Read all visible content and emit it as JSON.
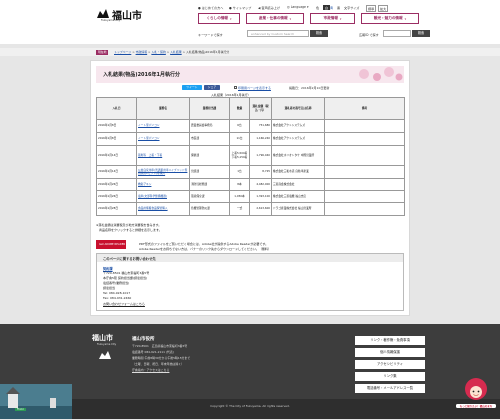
{
  "header": {
    "logo_text": "福山市",
    "logo_sub": "Fukuyama City",
    "util": [
      {
        "icon": "chevron-circle-icon",
        "label": "はじめての方へ"
      },
      {
        "icon": "chevron-circle-icon",
        "label": "サイトマップ"
      },
      {
        "icon": "speaker-icon",
        "label": "音声読み上げ"
      },
      {
        "icon": "globe-icon",
        "label": "Language"
      },
      {
        "label": "色",
        "selected": false
      },
      {
        "label": "白",
        "selected": true
      },
      {
        "label": "青",
        "selected": false
      },
      {
        "label": "黒",
        "selected": false
      },
      {
        "label": "文字サイズ"
      },
      {
        "label": "標準"
      },
      {
        "label": "拡大"
      }
    ],
    "nav": [
      "くらしの情報",
      "産業・仕事の情報",
      "市政情報",
      "観光・魅力の情報"
    ],
    "search": {
      "label": "キーワードで探す",
      "placeholder": "enhanced by Custom Search",
      "button": "検索"
    },
    "ad_search": {
      "label": "広報ID で探す",
      "button": "検索"
    }
  },
  "breadcrumb": {
    "tag": "現在地",
    "items": [
      "トップページ",
      "市政情報",
      "入札・契約",
      "入札結果",
      "入札結果(物品)2016年1月執行分"
    ]
  },
  "page": {
    "title": "入札結果(物品)2016年1月執行分",
    "tweet": "ツイート",
    "share": "シェア",
    "print": "印刷用ページを表示する",
    "updated": "掲載日：2016年2月10日更新",
    "caption": "入札結果（2016年1月執行）"
  },
  "table": {
    "headers": [
      "入札日",
      "業務名",
      "業務担当課",
      "数量",
      "落札金額（税込・円）",
      "落札者の商号又は名称",
      "備考"
    ],
    "rows": [
      {
        "date": "2016年1月8日",
        "name": "ノート型パソコン",
        "dept": "農業委員会事務局",
        "qty": "6台",
        "amount": "751,680",
        "winner": "株式会社アクトシステムズ",
        "note": ""
      },
      {
        "date": "2016年1月8日",
        "name": "ノート型パソコン",
        "dept": "市民課",
        "qty": "11台",
        "amount": "1,166,240",
        "winner": "株式会社アクトシステムズ",
        "note": ""
      },
      {
        "date": "2016年1月14日",
        "name": "薬剤等　上着・下着",
        "dept": "保健課",
        "qty": "上着5,500着 下着5,150着",
        "amount": "1,796,040",
        "winner": "株式会社ホリオトタケ 中国営業所",
        "note": ""
      },
      {
        "date": "2016年1月14日",
        "name": "公用自家用車(普通乗用車ハイブリッド型自家用Cセット)等購入",
        "dept": "営繕課",
        "qty": "1台",
        "amount": "8,725",
        "winner": "株式会社三和水道 自動車産業",
        "note": ""
      },
      {
        "date": "2016年1月26日",
        "name": "救助アキシ",
        "dept": "消防局総務課",
        "qty": "8本",
        "amount": "4,482,000",
        "winner": "三菱商会株式会社",
        "note": ""
      },
      {
        "date": "2016年1月26日",
        "name": "電車(文部科学整備機器)",
        "dept": "環境保全課",
        "qty": "1,050本",
        "amount": "1,393,100",
        "winner": "株式会社三菱電機 福山支店",
        "note": ""
      },
      {
        "date": "2016年1月28日",
        "name": "食品用備蓄食品保管購入",
        "dept": "危機管理防災課",
        "qty": "一式",
        "amount": "2,613,600",
        "winner": "ドラゴ産業株式会社 福山営業所",
        "note": ""
      }
    ]
  },
  "notes": [
    "※落札金額は消費税及び地方消費税を含みます。",
    "　商品名称をクリックすると詳細を表示します。"
  ],
  "pdf": {
    "badge": "Get ADOBE READER",
    "line1": "PDF形式のファイルをご覧いただく場合には、Adobe社が提供するAdobe Readerが必要です。",
    "line2": "Adobe Readerをお持ちでない方は、バナーのリンク先からダウンロードしてください。（無料）"
  },
  "contact": {
    "title": "このページに関するお問い合わせ先",
    "dept": "契約課",
    "lines": [
      "〒720-8501 福山市東桜町3番5号",
      "本庁舎5階 契約担当課(調達担当)",
      "電話番号(業務担当)",
      "調達担当",
      "Tel: 084-928-1017",
      "Fax: 084-931-2460"
    ],
    "link": "お問い合わせフォームはこちら"
  },
  "footer": {
    "logo_text": "福山市",
    "logo_sub": "Fukuyama City",
    "org": "福山市役所",
    "lines": [
      "〒720-8501　広島県福山市東桜町3番5号",
      "電話番号 084-921-2111 (代表)",
      "業務時間 午前8時30分から午後5時15分まで",
      "（土曜、日曜、祝日、年末年始は除く）",
      "庁舎案内・アクセスはこちら"
    ],
    "links": [
      "リンク・著作権・免責事項",
      "個人情報保護",
      "アクセシビリティ",
      "リンク集",
      "電話番号・メールアドレス一覧"
    ],
    "copyright": "Copyright © The City of Fukuyama. All rights reserved.",
    "badge_label": "Flickr",
    "mascot_caption": "もっと知りたい！福山のまち"
  },
  "colors": {
    "accent": "#9b2d63",
    "title_bg": "#f7e7ee",
    "footer_bg": "#3d3d3d"
  }
}
